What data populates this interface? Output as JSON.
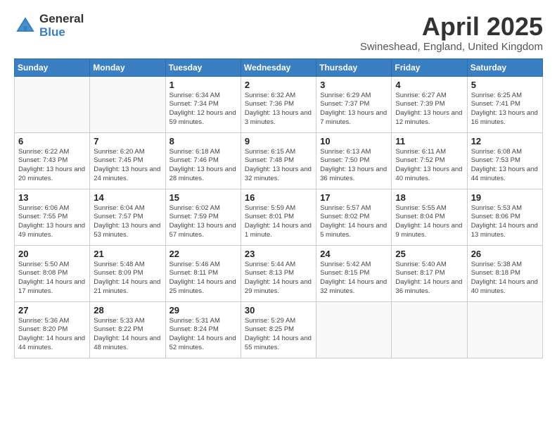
{
  "logo": {
    "general": "General",
    "blue": "Blue"
  },
  "header": {
    "title": "April 2025",
    "subtitle": "Swineshead, England, United Kingdom"
  },
  "days_of_week": [
    "Sunday",
    "Monday",
    "Tuesday",
    "Wednesday",
    "Thursday",
    "Friday",
    "Saturday"
  ],
  "weeks": [
    [
      {
        "day": "",
        "sunrise": "",
        "sunset": "",
        "daylight": ""
      },
      {
        "day": "",
        "sunrise": "",
        "sunset": "",
        "daylight": ""
      },
      {
        "day": "1",
        "sunrise": "Sunrise: 6:34 AM",
        "sunset": "Sunset: 7:34 PM",
        "daylight": "Daylight: 12 hours and 59 minutes."
      },
      {
        "day": "2",
        "sunrise": "Sunrise: 6:32 AM",
        "sunset": "Sunset: 7:36 PM",
        "daylight": "Daylight: 13 hours and 3 minutes."
      },
      {
        "day": "3",
        "sunrise": "Sunrise: 6:29 AM",
        "sunset": "Sunset: 7:37 PM",
        "daylight": "Daylight: 13 hours and 7 minutes."
      },
      {
        "day": "4",
        "sunrise": "Sunrise: 6:27 AM",
        "sunset": "Sunset: 7:39 PM",
        "daylight": "Daylight: 13 hours and 12 minutes."
      },
      {
        "day": "5",
        "sunrise": "Sunrise: 6:25 AM",
        "sunset": "Sunset: 7:41 PM",
        "daylight": "Daylight: 13 hours and 16 minutes."
      }
    ],
    [
      {
        "day": "6",
        "sunrise": "Sunrise: 6:22 AM",
        "sunset": "Sunset: 7:43 PM",
        "daylight": "Daylight: 13 hours and 20 minutes."
      },
      {
        "day": "7",
        "sunrise": "Sunrise: 6:20 AM",
        "sunset": "Sunset: 7:45 PM",
        "daylight": "Daylight: 13 hours and 24 minutes."
      },
      {
        "day": "8",
        "sunrise": "Sunrise: 6:18 AM",
        "sunset": "Sunset: 7:46 PM",
        "daylight": "Daylight: 13 hours and 28 minutes."
      },
      {
        "day": "9",
        "sunrise": "Sunrise: 6:15 AM",
        "sunset": "Sunset: 7:48 PM",
        "daylight": "Daylight: 13 hours and 32 minutes."
      },
      {
        "day": "10",
        "sunrise": "Sunrise: 6:13 AM",
        "sunset": "Sunset: 7:50 PM",
        "daylight": "Daylight: 13 hours and 36 minutes."
      },
      {
        "day": "11",
        "sunrise": "Sunrise: 6:11 AM",
        "sunset": "Sunset: 7:52 PM",
        "daylight": "Daylight: 13 hours and 40 minutes."
      },
      {
        "day": "12",
        "sunrise": "Sunrise: 6:08 AM",
        "sunset": "Sunset: 7:53 PM",
        "daylight": "Daylight: 13 hours and 44 minutes."
      }
    ],
    [
      {
        "day": "13",
        "sunrise": "Sunrise: 6:06 AM",
        "sunset": "Sunset: 7:55 PM",
        "daylight": "Daylight: 13 hours and 49 minutes."
      },
      {
        "day": "14",
        "sunrise": "Sunrise: 6:04 AM",
        "sunset": "Sunset: 7:57 PM",
        "daylight": "Daylight: 13 hours and 53 minutes."
      },
      {
        "day": "15",
        "sunrise": "Sunrise: 6:02 AM",
        "sunset": "Sunset: 7:59 PM",
        "daylight": "Daylight: 13 hours and 57 minutes."
      },
      {
        "day": "16",
        "sunrise": "Sunrise: 5:59 AM",
        "sunset": "Sunset: 8:01 PM",
        "daylight": "Daylight: 14 hours and 1 minute."
      },
      {
        "day": "17",
        "sunrise": "Sunrise: 5:57 AM",
        "sunset": "Sunset: 8:02 PM",
        "daylight": "Daylight: 14 hours and 5 minutes."
      },
      {
        "day": "18",
        "sunrise": "Sunrise: 5:55 AM",
        "sunset": "Sunset: 8:04 PM",
        "daylight": "Daylight: 14 hours and 9 minutes."
      },
      {
        "day": "19",
        "sunrise": "Sunrise: 5:53 AM",
        "sunset": "Sunset: 8:06 PM",
        "daylight": "Daylight: 14 hours and 13 minutes."
      }
    ],
    [
      {
        "day": "20",
        "sunrise": "Sunrise: 5:50 AM",
        "sunset": "Sunset: 8:08 PM",
        "daylight": "Daylight: 14 hours and 17 minutes."
      },
      {
        "day": "21",
        "sunrise": "Sunrise: 5:48 AM",
        "sunset": "Sunset: 8:09 PM",
        "daylight": "Daylight: 14 hours and 21 minutes."
      },
      {
        "day": "22",
        "sunrise": "Sunrise: 5:46 AM",
        "sunset": "Sunset: 8:11 PM",
        "daylight": "Daylight: 14 hours and 25 minutes."
      },
      {
        "day": "23",
        "sunrise": "Sunrise: 5:44 AM",
        "sunset": "Sunset: 8:13 PM",
        "daylight": "Daylight: 14 hours and 29 minutes."
      },
      {
        "day": "24",
        "sunrise": "Sunrise: 5:42 AM",
        "sunset": "Sunset: 8:15 PM",
        "daylight": "Daylight: 14 hours and 32 minutes."
      },
      {
        "day": "25",
        "sunrise": "Sunrise: 5:40 AM",
        "sunset": "Sunset: 8:17 PM",
        "daylight": "Daylight: 14 hours and 36 minutes."
      },
      {
        "day": "26",
        "sunrise": "Sunrise: 5:38 AM",
        "sunset": "Sunset: 8:18 PM",
        "daylight": "Daylight: 14 hours and 40 minutes."
      }
    ],
    [
      {
        "day": "27",
        "sunrise": "Sunrise: 5:36 AM",
        "sunset": "Sunset: 8:20 PM",
        "daylight": "Daylight: 14 hours and 44 minutes."
      },
      {
        "day": "28",
        "sunrise": "Sunrise: 5:33 AM",
        "sunset": "Sunset: 8:22 PM",
        "daylight": "Daylight: 14 hours and 48 minutes."
      },
      {
        "day": "29",
        "sunrise": "Sunrise: 5:31 AM",
        "sunset": "Sunset: 8:24 PM",
        "daylight": "Daylight: 14 hours and 52 minutes."
      },
      {
        "day": "30",
        "sunrise": "Sunrise: 5:29 AM",
        "sunset": "Sunset: 8:25 PM",
        "daylight": "Daylight: 14 hours and 55 minutes."
      },
      {
        "day": "",
        "sunrise": "",
        "sunset": "",
        "daylight": ""
      },
      {
        "day": "",
        "sunrise": "",
        "sunset": "",
        "daylight": ""
      },
      {
        "day": "",
        "sunrise": "",
        "sunset": "",
        "daylight": ""
      }
    ]
  ]
}
